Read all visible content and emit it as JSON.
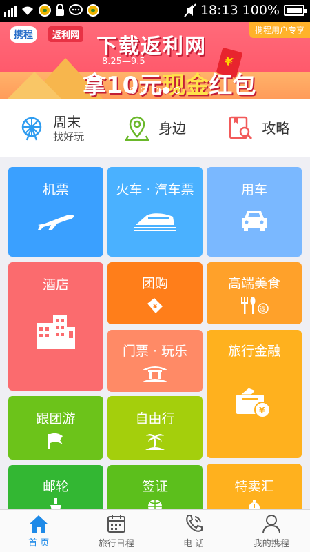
{
  "status_bar": {
    "time": "18:13",
    "battery": "100%"
  },
  "banner": {
    "ctrip_logo": "携程",
    "fanli_logo": "返利网",
    "title": "下载返利网",
    "date": "8.25—9.5",
    "sub_prefix": "拿10元",
    "sub_gold": "现金",
    "sub_suffix": "红包",
    "tag": "携程用户专享",
    "page_count": 5,
    "active_page": 4
  },
  "quick": [
    {
      "main": "周末",
      "sub": "找好玩",
      "icon": "ferris-wheel-icon"
    },
    {
      "main": "身边",
      "sub": "",
      "icon": "location-pin-icon"
    },
    {
      "main": "攻略",
      "sub": "",
      "icon": "guide-search-icon"
    }
  ],
  "tiles": {
    "flight": "机票",
    "train": "火车 · 汽车票",
    "car": "用车",
    "hotel": "酒店",
    "group": "团购",
    "food": "高端美食",
    "ticket": "门票 · 玩乐",
    "finance": "旅行金融",
    "tour": "跟团游",
    "free": "自由行",
    "cruise": "邮轮",
    "visa": "签证",
    "sale": "特卖汇"
  },
  "tabbar": [
    {
      "label": "首 页",
      "icon": "home-icon",
      "active": true
    },
    {
      "label": "旅行日程",
      "icon": "calendar-icon",
      "active": false
    },
    {
      "label": "电 话",
      "icon": "phone-icon",
      "active": false
    },
    {
      "label": "我的携程",
      "icon": "user-icon",
      "active": false
    }
  ],
  "colors": {
    "accent": "#1e8ae8",
    "flight": "#3aa0ff",
    "hotel": "#fb6b6e",
    "group": "#ff7e1a",
    "finance": "#ffb11e",
    "tour": "#6cc31a"
  }
}
